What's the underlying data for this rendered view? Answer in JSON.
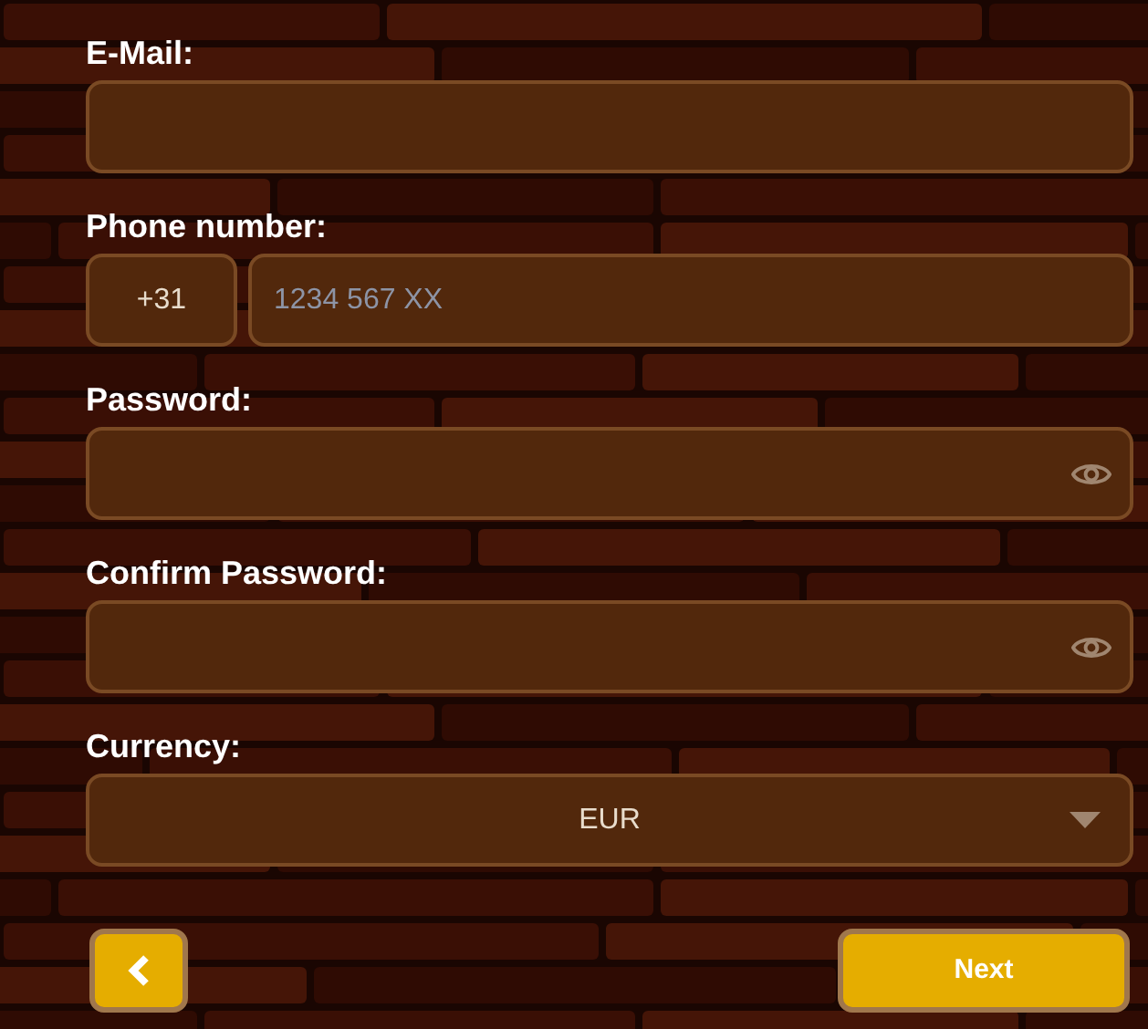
{
  "fields": [
    {
      "kind": "text",
      "label": "E-Mail:"
    },
    {
      "kind": "phone",
      "label": "Phone number:",
      "prefix": "+31",
      "placeholder": "1234 567 XX"
    },
    {
      "kind": "password",
      "label": "Password:"
    },
    {
      "kind": "password",
      "label": "Confirm Password:"
    },
    {
      "kind": "select",
      "label": "Currency:",
      "value": "EUR"
    }
  ],
  "buttons": {
    "back": {
      "kind": "back"
    },
    "next": {
      "kind": "next",
      "label": "Next"
    }
  }
}
